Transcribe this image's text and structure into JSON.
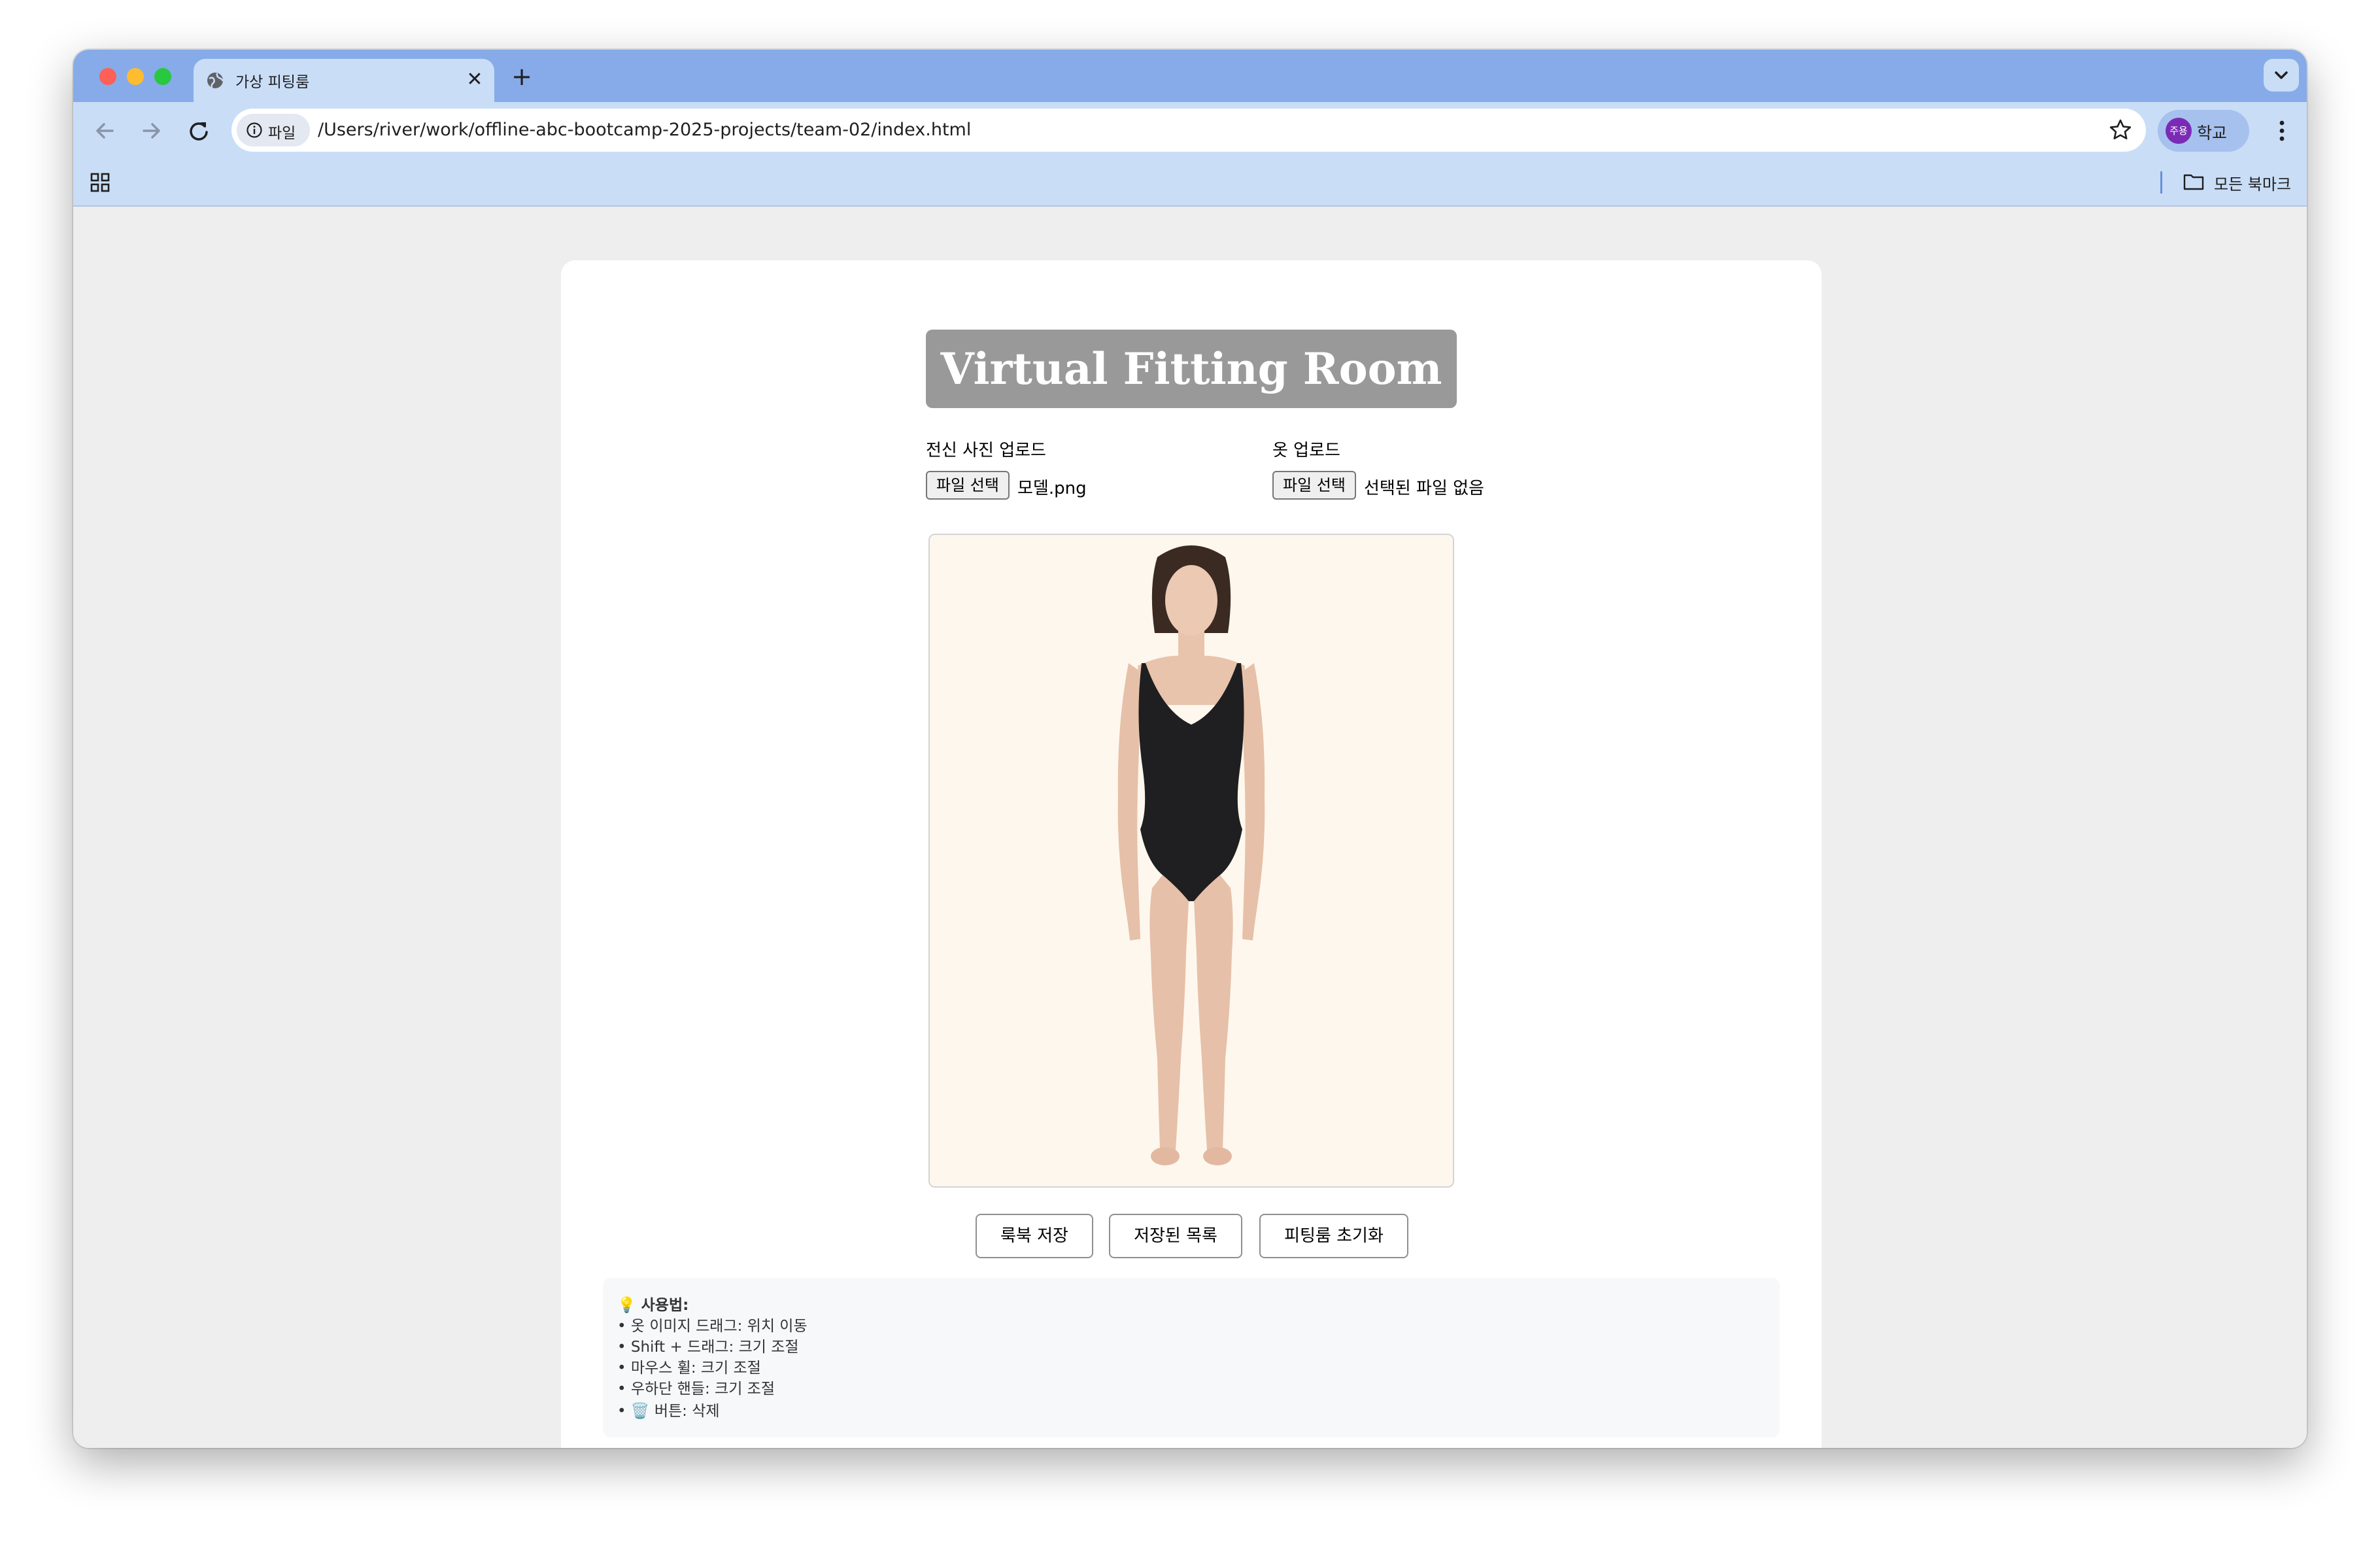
{
  "browser": {
    "tab": {
      "title": "가상 피팅룸",
      "close_glyph": "✕"
    },
    "new_tab_glyph": "+",
    "address": {
      "chip_label": "파일",
      "url": "/Users/river/work/offline-abc-bootcamp-2025-projects/team-02/index.html"
    },
    "profile": {
      "badge": "주용",
      "name": "학교"
    },
    "bookmarks": {
      "all_label": "모든 북마크"
    },
    "colors": {
      "tab_strip": "#86abe8",
      "toolbar": "#c9ddf7",
      "avatar": "#7a2bb6"
    }
  },
  "page": {
    "title": "Virtual Fitting Room",
    "uploads": {
      "body_photo": {
        "label": "전신 사진 업로드",
        "button": "파일 선택",
        "file_name": "모델.png"
      },
      "clothes": {
        "label": "옷 업로드",
        "button": "파일 선택",
        "file_name": "선택된 파일 없음"
      }
    },
    "actions": {
      "save": "룩북 저장",
      "saved_list": "저장된 목록",
      "reset": "피팅룸 초기화"
    },
    "help": {
      "title": "💡 사용법:",
      "lines": [
        "• 옷 이미지 드래그: 위치 이동",
        "• Shift + 드래그: 크기 조절",
        "• 마우스 휠: 크기 조절",
        "• 우하단 핸들: 크기 조절",
        "• 🗑️ 버튼: 삭제"
      ]
    },
    "colors": {
      "title_bg": "#999999",
      "canvas_bg": "#fef7ed",
      "help_bg": "#f7f8fa"
    }
  }
}
